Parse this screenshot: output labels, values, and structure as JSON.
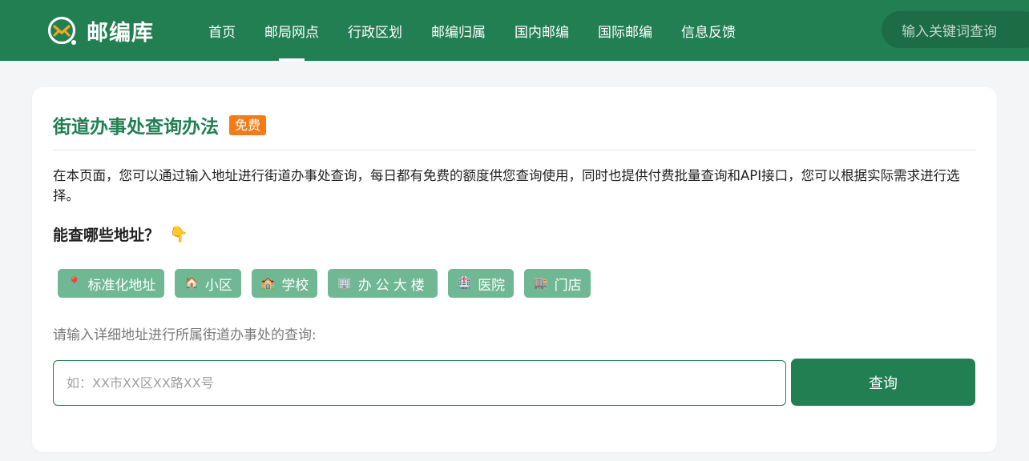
{
  "header": {
    "logo_text": "邮编库",
    "nav": [
      {
        "label": "首页"
      },
      {
        "label": "邮局网点",
        "active": true
      },
      {
        "label": "行政区划"
      },
      {
        "label": "邮编归属"
      },
      {
        "label": "国内邮编"
      },
      {
        "label": "国际邮编"
      },
      {
        "label": "信息反馈"
      }
    ],
    "search_placeholder": "输入关键词查询"
  },
  "colors": {
    "brand_green": "#217f52",
    "badge_orange": "#f47b16",
    "tag_green": "#6fb893"
  },
  "main": {
    "title": "街道办事处查询办法",
    "badge": "免费",
    "description": "在本页面，您可以通过输入地址进行街道办事处查询，每日都有免费的额度供您查询使用，同时也提供付费批量查询和API接口，您可以根据实际需求进行选择。",
    "subheading": "能查哪些地址？",
    "subheading_emoji": "👇",
    "tags": [
      {
        "icon": "📍",
        "icon_name": "pin-icon",
        "label": "标准化地址"
      },
      {
        "icon": "🏠",
        "icon_name": "house-icon",
        "label": "小区"
      },
      {
        "icon": "🏫",
        "icon_name": "school-icon",
        "label": "学校"
      },
      {
        "icon": "🏢",
        "icon_name": "office-building-icon",
        "label": "办公大楼"
      },
      {
        "icon": "🏥",
        "icon_name": "hospital-icon",
        "label": "医院"
      },
      {
        "icon": "🏬",
        "icon_name": "store-icon",
        "label": "门店"
      }
    ],
    "prompt": "请输入详细地址进行所属街道办事处的查询:",
    "input_placeholder": "如：XX市XX区XX路XX号",
    "input_value": "",
    "button_label": "查询"
  }
}
